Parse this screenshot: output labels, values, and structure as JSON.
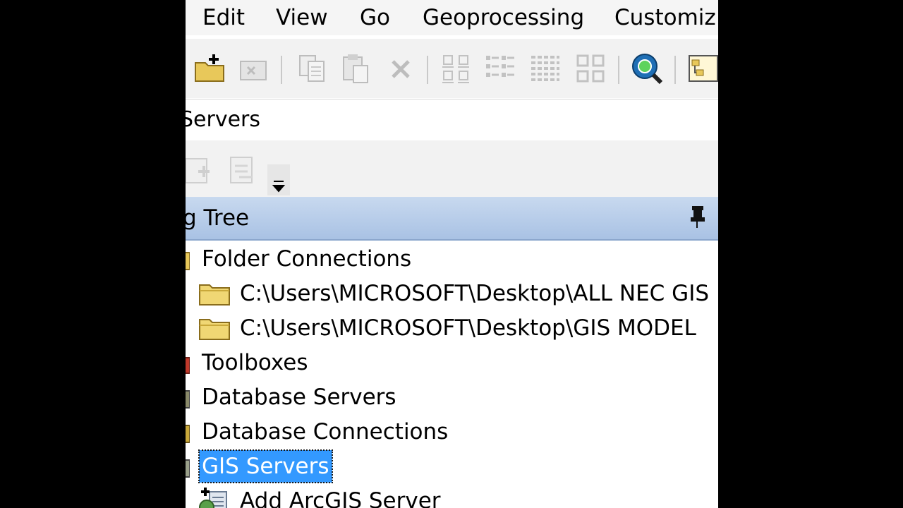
{
  "menu": [
    "Edit",
    "View",
    "Go",
    "Geoprocessing",
    "Customiz"
  ],
  "address": {
    "value": "Servers"
  },
  "panel": {
    "title": "g Tree"
  },
  "tree": {
    "items": [
      {
        "label": "Folder Connections"
      },
      {
        "label": "C:\\Users\\MICROSOFT\\Desktop\\ALL NEC GIS"
      },
      {
        "label": "C:\\Users\\MICROSOFT\\Desktop\\GIS MODEL"
      },
      {
        "label": "Toolboxes"
      },
      {
        "label": "Database Servers"
      },
      {
        "label": "Database Connections"
      },
      {
        "label": "GIS Servers"
      },
      {
        "label": "Add ArcGIS Server"
      }
    ]
  },
  "colors": {
    "selection": "#3399ff",
    "panel_header": "#b7cdea",
    "folder": "#e8c85a"
  },
  "icons": [
    "new-folder-icon",
    "disconnect-folder-icon",
    "copy-icon",
    "paste-icon",
    "delete-icon",
    "large-icons-view-icon",
    "list-view-icon",
    "details-view-icon",
    "thumbnails-view-icon",
    "search-icon",
    "arccatalog-options-icon",
    "pin-icon",
    "folder-icon",
    "server-icon"
  ]
}
